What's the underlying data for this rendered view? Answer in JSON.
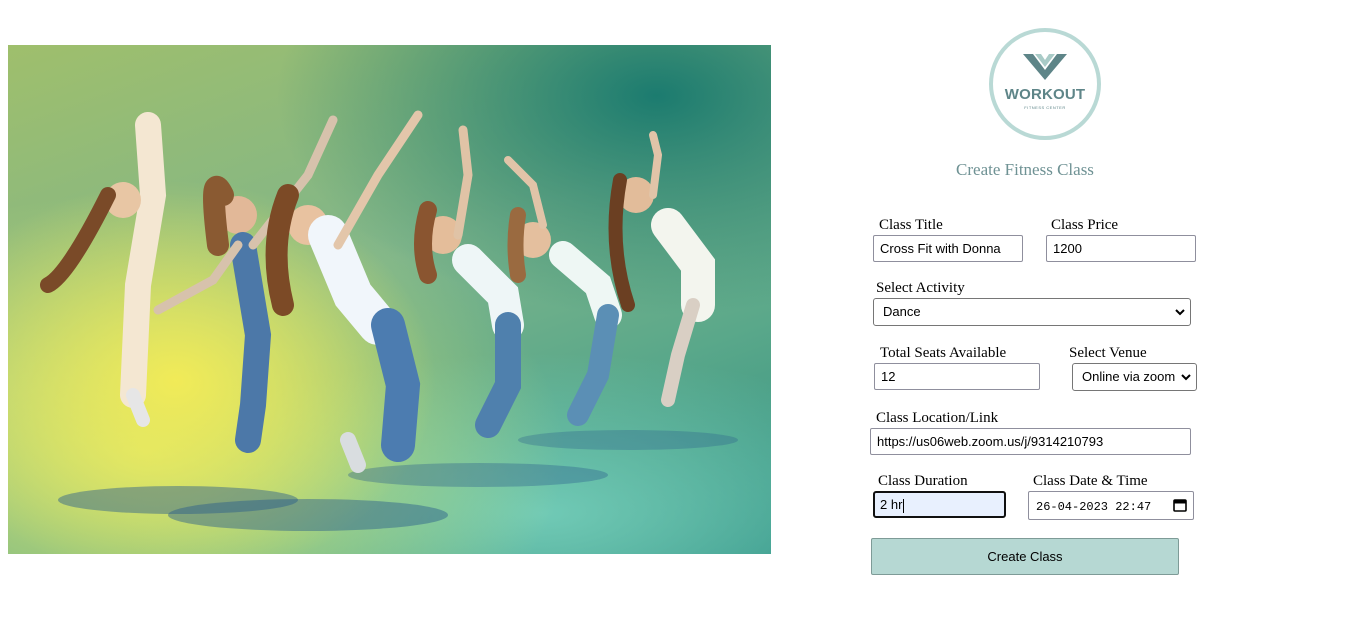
{
  "logo": {
    "wordmark": "WORKOUT",
    "tagline": "FITNESS CENTER",
    "accent": "#5e8588",
    "ring": "#b9d9d5"
  },
  "hero": {
    "icon": "dance-photo"
  },
  "form": {
    "title": "Create Fitness Class",
    "class_title": {
      "label": "Class Title",
      "value": "Cross Fit with Donna"
    },
    "class_price": {
      "label": "Class Price",
      "value": "1200"
    },
    "activity": {
      "label": "Select Activity",
      "selected": "Dance"
    },
    "seats": {
      "label": "Total Seats Available",
      "value": "12"
    },
    "venue": {
      "label": "Select Venue",
      "selected": "Online via zoom"
    },
    "location": {
      "label": "Class Location/Link",
      "value": "https://us06web.zoom.us/j/9314210793"
    },
    "duration": {
      "label": "Class Duration",
      "value": "2 hr"
    },
    "datetime": {
      "label": "Class Date & Time",
      "value": "26-04-2023  22:47"
    },
    "submit": "Create Class"
  },
  "colors": {
    "button": "#b6d8d3",
    "title": "#6f9294",
    "focus_bg": "#e8f0fe"
  }
}
